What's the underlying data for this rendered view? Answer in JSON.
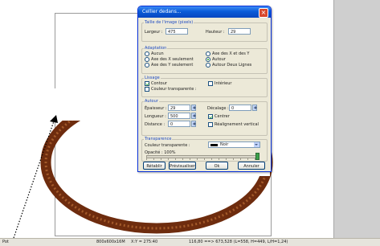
{
  "dialog": {
    "title": "Cellier dedans...",
    "image_size": {
      "title": "Taille de l'image (pixels)",
      "width_label": "Largeur :",
      "width_value": "475",
      "height_label": "Hauteur :",
      "height_value": "29"
    },
    "adaptation": {
      "title": "Adaptation",
      "options": [
        "Aucun",
        "Axe des X seulement",
        "Axe des Y seulement",
        "Axe des X et des Y",
        "Autour",
        "Autour Deux Lignes"
      ],
      "selected": "Autour"
    },
    "lissage": {
      "title": "Lissage",
      "contour_label": "Contour",
      "contour_checked": true,
      "interieur_label": "Intérieur",
      "interieur_checked": false,
      "transparent_color_label": "Couleur transparente :"
    },
    "autour": {
      "title": "Autour",
      "epaisseur_label": "Épaisseur :",
      "epaisseur_value": "29",
      "longueur_label": "Longueur :",
      "longueur_value": "500",
      "distance_label": "Distance :",
      "distance_value": "0",
      "decalage_label": "Décalage :",
      "decalage_value": "0",
      "centrer_label": "Centrer",
      "centrer_checked": true,
      "realignement_label": "Réalignement vertical",
      "realignement_checked": false
    },
    "transparence": {
      "title": "Transparence",
      "color_label": "Couleur transparente :",
      "color_value": "Noir",
      "opacity_label": "Opacité : 100%",
      "opacity_level": 1.0
    },
    "buttons": {
      "reset": "Rétablir",
      "preview": "Prévisualiser",
      "ok": "Ok",
      "cancel": "Annuler"
    }
  },
  "statusbar": {
    "mode": "Pot",
    "dimensions": "800x600x16M",
    "coords": "X:Y = 275:40",
    "selection": "116,80 ==> 673,528 (L=558, H=449, L/H=1,24)"
  },
  "colors": {
    "ring": "#6e2c0e",
    "titlebar": "#0a5bd8",
    "dialog_bg": "#ece9d8"
  }
}
